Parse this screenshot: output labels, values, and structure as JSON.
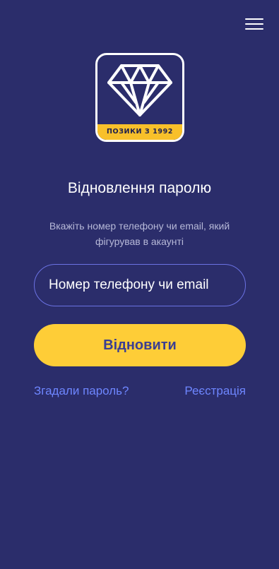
{
  "header": {
    "menu_icon": "hamburger-menu-icon"
  },
  "logo": {
    "icon": "diamond-icon",
    "tagline": "ПОЗИКИ З 1992",
    "tagline_color": "#f8c02a"
  },
  "recovery": {
    "title": "Відновлення паролю",
    "subtitle": "Вкажіть номер телефону чи email, який фігурував в акаунті",
    "input_placeholder": "Номер телефону чи email",
    "input_value": "",
    "submit_label": "Відновити"
  },
  "links": {
    "forgot": "Згадали пароль?",
    "register": "Реєстрація"
  },
  "colors": {
    "background": "#2b2d6b",
    "accent": "#fecd37",
    "link": "#6e86ff",
    "input_border": "#6b72e3"
  }
}
